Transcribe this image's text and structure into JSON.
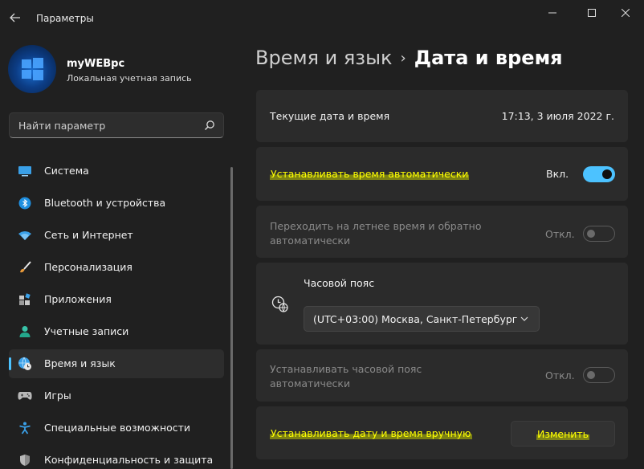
{
  "window": {
    "title": "Параметры",
    "controls": [
      "minimize-icon",
      "maximize-icon",
      "close-icon"
    ]
  },
  "profile": {
    "name": "myWEBpc",
    "account_type": "Локальная учетная запись"
  },
  "search": {
    "placeholder": "Найти параметр"
  },
  "sidebar": {
    "items": [
      {
        "label": "Система",
        "icon": "monitor-icon"
      },
      {
        "label": "Bluetooth и устройства",
        "icon": "bluetooth-icon"
      },
      {
        "label": "Сеть и Интернет",
        "icon": "wifi-icon"
      },
      {
        "label": "Персонализация",
        "icon": "brush-icon"
      },
      {
        "label": "Приложения",
        "icon": "apps-icon"
      },
      {
        "label": "Учетные записи",
        "icon": "person-icon"
      },
      {
        "label": "Время и язык",
        "icon": "globe-clock-icon",
        "active": true
      },
      {
        "label": "Игры",
        "icon": "gamepad-icon"
      },
      {
        "label": "Специальные возможности",
        "icon": "accessibility-icon"
      },
      {
        "label": "Конфиденциальность и защита",
        "icon": "shield-icon"
      }
    ]
  },
  "breadcrumb": {
    "parent": "Время и язык",
    "separator": "›",
    "current": "Дата и время"
  },
  "cards": {
    "current_datetime": {
      "label": "Текущие дата и время",
      "value": "17:13, 3 июля 2022 г."
    },
    "auto_time": {
      "label": "Устанавливать время автоматически",
      "state_text": "Вкл.",
      "on": true
    },
    "dst": {
      "label_line1": "Переходить на летнее время и обратно",
      "label_line2": "автоматически",
      "state_text": "Откл.",
      "on": false,
      "disabled": true
    },
    "timezone": {
      "label": "Часовой пояс",
      "value": "(UTC+03:00) Москва, Санкт-Петербург"
    },
    "auto_timezone": {
      "label_line1": "Устанавливать часовой пояс",
      "label_line2": "автоматически",
      "state_text": "Откл.",
      "on": false,
      "disabled": true
    },
    "manual": {
      "label": "Устанавливать дату и время вручную",
      "button": "Изменить"
    }
  },
  "colors": {
    "accent": "#4cc2ff",
    "background": "#202020",
    "card": "#2b2b2b",
    "highlight": "#ffff00"
  }
}
